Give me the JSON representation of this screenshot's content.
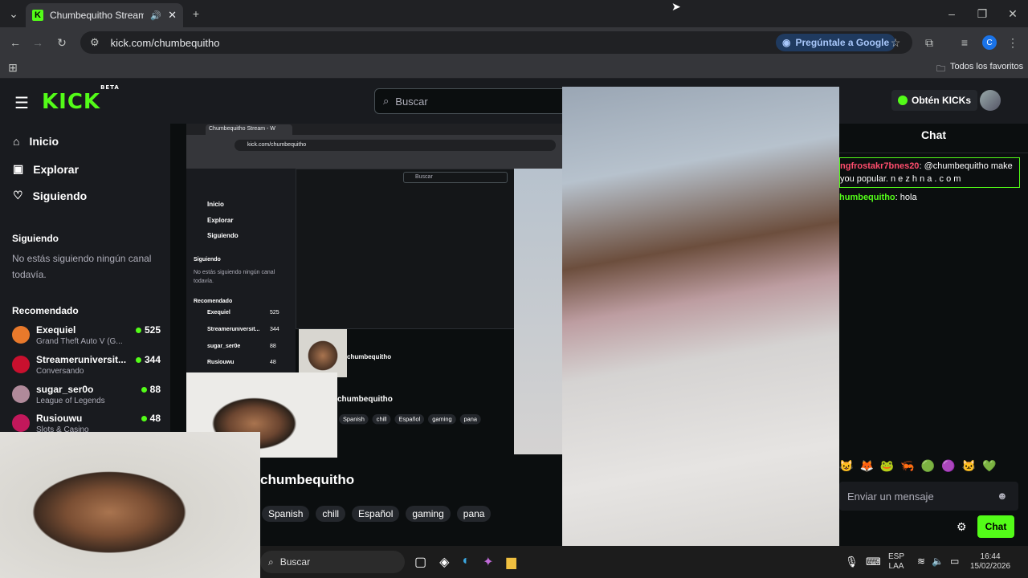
{
  "browser": {
    "tab_title": "Chumbequitho Stream - W",
    "url": "kick.com/chumbequitho",
    "google_button": "Pregúntale a Google",
    "profile_initial": "C",
    "bookmarks_label": "Todos los favoritos"
  },
  "site": {
    "logo": "KICK",
    "logo_badge": "BETA",
    "search_placeholder": "Buscar",
    "kicks_button": "Obtén KICKs",
    "nav": [
      {
        "label": "Inicio"
      },
      {
        "label": "Explorar"
      },
      {
        "label": "Siguiendo"
      }
    ],
    "following_title": "Siguiendo",
    "following_empty": "No estás siguiendo ningún canal todavía.",
    "recommended_title": "Recomendado",
    "recommended": [
      {
        "name": "Exequiel",
        "game": "Grand Theft Auto V (G...",
        "viewers": "525",
        "color": "#e8792b"
      },
      {
        "name": "Streameruniversit...",
        "game": "Conversando",
        "viewers": "344",
        "color": "#c8102e"
      },
      {
        "name": "sugar_ser0o",
        "game": "League of Legends",
        "viewers": "88",
        "color": "#b08a9a"
      },
      {
        "name": "Rusiouwu",
        "game": "Slots & Casino",
        "viewers": "48",
        "color": "#c2185b"
      }
    ],
    "channel_name": "chumbequitho",
    "tags": [
      "Spanish",
      "chill",
      "Español",
      "gaming",
      "pana"
    ]
  },
  "nested": {
    "tab_title": "Chumbequitho Stream - W",
    "url": "kick.com/chumbequitho",
    "nav": [
      "Inicio",
      "Explorar",
      "Siguiendo"
    ],
    "following_title": "Siguiendo",
    "following_empty": "No estás siguiendo ningún canal todavía.",
    "recommended_title": "Recomendado",
    "recommended": [
      {
        "name": "Exequiel",
        "game": "Grand Theft Auto V (G...",
        "viewers": "525"
      },
      {
        "name": "Streameruniversit...",
        "game": "Conversando",
        "viewers": "344"
      },
      {
        "name": "sugar_ser0e",
        "game": "League of Legends",
        "viewers": "88"
      },
      {
        "name": "Rusiouwu",
        "game": "Slots & Casino",
        "viewers": "48"
      }
    ],
    "channel_name": "chumbequitho",
    "search": "Buscar"
  },
  "chat": {
    "title": "Chat",
    "messages": [
      {
        "user": "ngfrostakr7bnes20",
        "user_color": "#ff4d6d",
        "text": "@chumbequitho make you popular. n e z h n a . c o m"
      },
      {
        "user": "humbequitho",
        "user_color": "#53fc18",
        "text": "hola"
      }
    ],
    "input_placeholder": "Enviar un mensaje",
    "send_button": "Chat"
  },
  "taskbar": {
    "search": "Buscar",
    "language": "ESP",
    "layout": "LAA",
    "time": "16:44",
    "date": "15/02/2026"
  },
  "colors": {
    "accent": "#53fc18",
    "panel": "#191b1f",
    "background": "#0b0e0f"
  }
}
